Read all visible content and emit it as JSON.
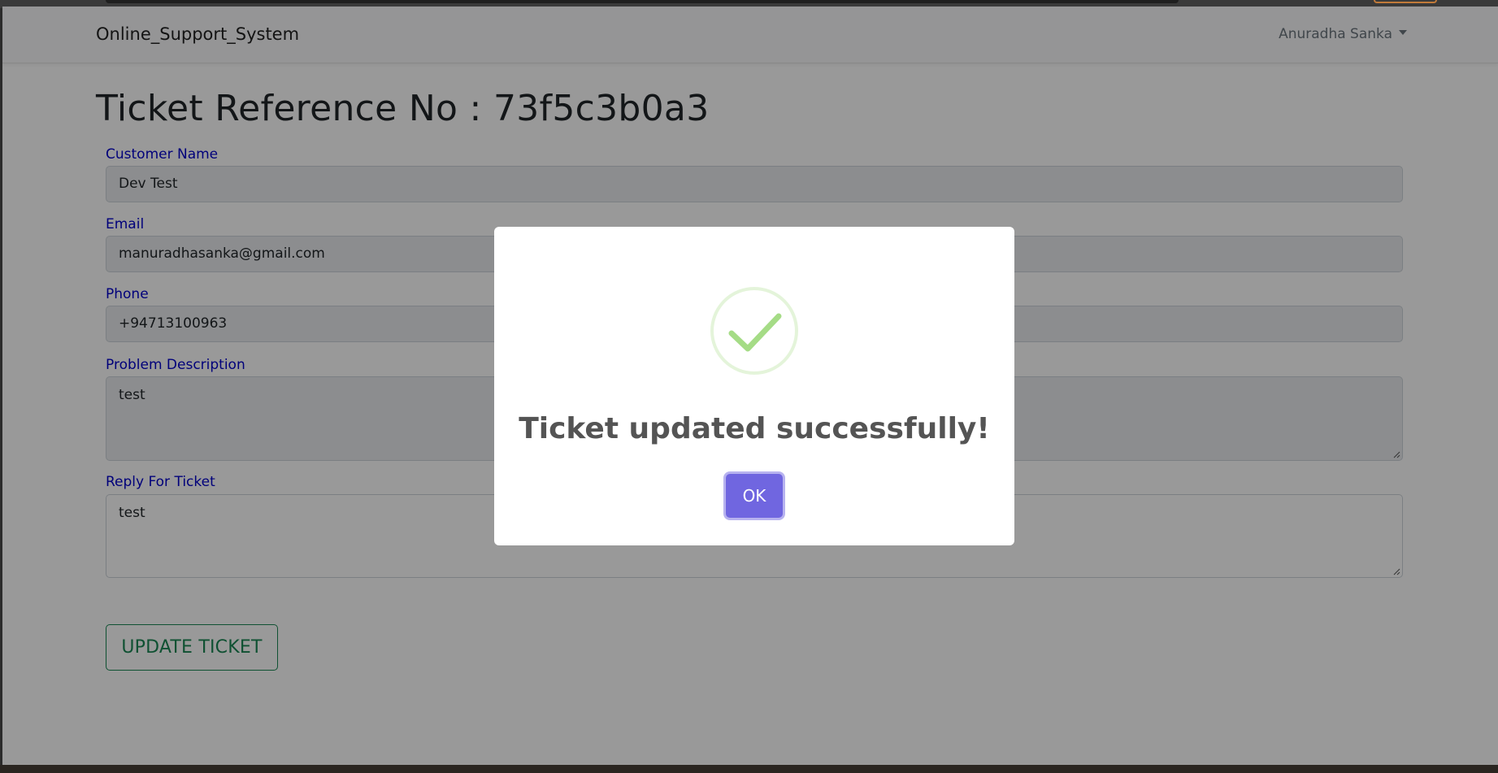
{
  "navbar": {
    "brand": "Online_Support_System",
    "user": "Anuradha Sanka"
  },
  "page": {
    "title": "Ticket Reference No : 73f5c3b0a3"
  },
  "form": {
    "customer_name": {
      "label": "Customer Name",
      "value": "Dev Test"
    },
    "email": {
      "label": "Email",
      "value": "manuradhasanka@gmail.com"
    },
    "phone": {
      "label": "Phone",
      "value": "+94713100963"
    },
    "problem": {
      "label": "Problem Description",
      "value": "test"
    },
    "reply": {
      "label": "Reply For Ticket",
      "value": "test"
    },
    "update_button": "UPDATE TICKET"
  },
  "modal": {
    "message": "Ticket updated successfully!",
    "ok_button": "OK",
    "icon": "success-check-icon"
  },
  "colors": {
    "label_blue": "#0000cc",
    "success_green": "#a5dc86",
    "ok_purple": "#7066e0",
    "update_green": "#198754"
  }
}
